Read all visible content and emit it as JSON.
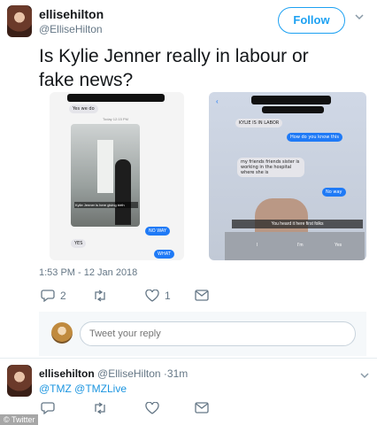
{
  "tweet": {
    "display_name": "ellisehilton",
    "handle": "@ElliseHilton",
    "follow_label": "Follow",
    "text": "Is Kylie Jenner really in labour or fake news?",
    "timestamp": "1:53 PM - 12 Jan 2018",
    "actions": {
      "reply_count": "2",
      "retweet_count": "",
      "like_count": "1"
    }
  },
  "screenshot_left": {
    "bubble_1": "Yes we do",
    "header_time": "Today 12:15 PM",
    "caption": "Kylie Jenner is here giving birth",
    "bubble_2": "NO WAY",
    "bubble_3": "YES",
    "bubble_4": "WHAT"
  },
  "screenshot_right": {
    "bubble_1": "KYLIE IS IN LABOR",
    "bubble_2": "How do you know this",
    "bubble_3": "my friends friends sister is working in the hospital where she is",
    "bubble_4": "No way",
    "bubble_5": "You heard it here first folks",
    "kb_1": "I",
    "kb_2": "I'm",
    "kb_3": "Yes"
  },
  "reply": {
    "placeholder": "Tweet your reply"
  },
  "reply_tweet": {
    "display_name": "ellisehilton",
    "handle": "@ElliseHilton",
    "age": "·31m",
    "text": "@TMZ @TMZLive"
  },
  "watermark": "© Twitter",
  "colors": {
    "accent": "#1da1f2",
    "text": "#14171a",
    "secondary": "#657786"
  }
}
